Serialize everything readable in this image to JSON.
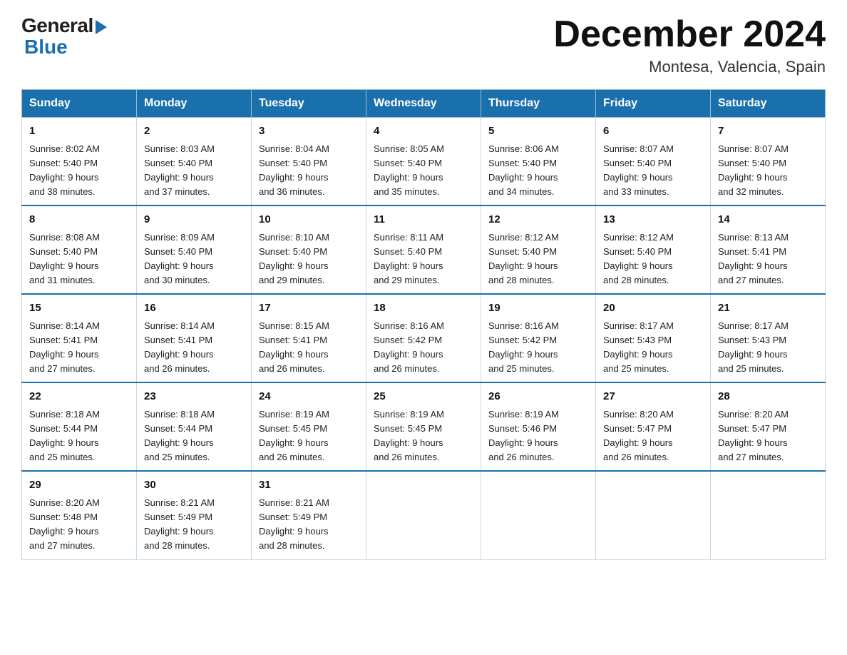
{
  "header": {
    "logo": {
      "general": "General",
      "blue": "Blue"
    },
    "title": "December 2024",
    "location": "Montesa, Valencia, Spain"
  },
  "calendar": {
    "days_of_week": [
      "Sunday",
      "Monday",
      "Tuesday",
      "Wednesday",
      "Thursday",
      "Friday",
      "Saturday"
    ],
    "weeks": [
      [
        {
          "day": "1",
          "sunrise": "8:02 AM",
          "sunset": "5:40 PM",
          "daylight": "9 hours and 38 minutes."
        },
        {
          "day": "2",
          "sunrise": "8:03 AM",
          "sunset": "5:40 PM",
          "daylight": "9 hours and 37 minutes."
        },
        {
          "day": "3",
          "sunrise": "8:04 AM",
          "sunset": "5:40 PM",
          "daylight": "9 hours and 36 minutes."
        },
        {
          "day": "4",
          "sunrise": "8:05 AM",
          "sunset": "5:40 PM",
          "daylight": "9 hours and 35 minutes."
        },
        {
          "day": "5",
          "sunrise": "8:06 AM",
          "sunset": "5:40 PM",
          "daylight": "9 hours and 34 minutes."
        },
        {
          "day": "6",
          "sunrise": "8:07 AM",
          "sunset": "5:40 PM",
          "daylight": "9 hours and 33 minutes."
        },
        {
          "day": "7",
          "sunrise": "8:07 AM",
          "sunset": "5:40 PM",
          "daylight": "9 hours and 32 minutes."
        }
      ],
      [
        {
          "day": "8",
          "sunrise": "8:08 AM",
          "sunset": "5:40 PM",
          "daylight": "9 hours and 31 minutes."
        },
        {
          "day": "9",
          "sunrise": "8:09 AM",
          "sunset": "5:40 PM",
          "daylight": "9 hours and 30 minutes."
        },
        {
          "day": "10",
          "sunrise": "8:10 AM",
          "sunset": "5:40 PM",
          "daylight": "9 hours and 29 minutes."
        },
        {
          "day": "11",
          "sunrise": "8:11 AM",
          "sunset": "5:40 PM",
          "daylight": "9 hours and 29 minutes."
        },
        {
          "day": "12",
          "sunrise": "8:12 AM",
          "sunset": "5:40 PM",
          "daylight": "9 hours and 28 minutes."
        },
        {
          "day": "13",
          "sunrise": "8:12 AM",
          "sunset": "5:40 PM",
          "daylight": "9 hours and 28 minutes."
        },
        {
          "day": "14",
          "sunrise": "8:13 AM",
          "sunset": "5:41 PM",
          "daylight": "9 hours and 27 minutes."
        }
      ],
      [
        {
          "day": "15",
          "sunrise": "8:14 AM",
          "sunset": "5:41 PM",
          "daylight": "9 hours and 27 minutes."
        },
        {
          "day": "16",
          "sunrise": "8:14 AM",
          "sunset": "5:41 PM",
          "daylight": "9 hours and 26 minutes."
        },
        {
          "day": "17",
          "sunrise": "8:15 AM",
          "sunset": "5:41 PM",
          "daylight": "9 hours and 26 minutes."
        },
        {
          "day": "18",
          "sunrise": "8:16 AM",
          "sunset": "5:42 PM",
          "daylight": "9 hours and 26 minutes."
        },
        {
          "day": "19",
          "sunrise": "8:16 AM",
          "sunset": "5:42 PM",
          "daylight": "9 hours and 25 minutes."
        },
        {
          "day": "20",
          "sunrise": "8:17 AM",
          "sunset": "5:43 PM",
          "daylight": "9 hours and 25 minutes."
        },
        {
          "day": "21",
          "sunrise": "8:17 AM",
          "sunset": "5:43 PM",
          "daylight": "9 hours and 25 minutes."
        }
      ],
      [
        {
          "day": "22",
          "sunrise": "8:18 AM",
          "sunset": "5:44 PM",
          "daylight": "9 hours and 25 minutes."
        },
        {
          "day": "23",
          "sunrise": "8:18 AM",
          "sunset": "5:44 PM",
          "daylight": "9 hours and 25 minutes."
        },
        {
          "day": "24",
          "sunrise": "8:19 AM",
          "sunset": "5:45 PM",
          "daylight": "9 hours and 26 minutes."
        },
        {
          "day": "25",
          "sunrise": "8:19 AM",
          "sunset": "5:45 PM",
          "daylight": "9 hours and 26 minutes."
        },
        {
          "day": "26",
          "sunrise": "8:19 AM",
          "sunset": "5:46 PM",
          "daylight": "9 hours and 26 minutes."
        },
        {
          "day": "27",
          "sunrise": "8:20 AM",
          "sunset": "5:47 PM",
          "daylight": "9 hours and 26 minutes."
        },
        {
          "day": "28",
          "sunrise": "8:20 AM",
          "sunset": "5:47 PM",
          "daylight": "9 hours and 27 minutes."
        }
      ],
      [
        {
          "day": "29",
          "sunrise": "8:20 AM",
          "sunset": "5:48 PM",
          "daylight": "9 hours and 27 minutes."
        },
        {
          "day": "30",
          "sunrise": "8:21 AM",
          "sunset": "5:49 PM",
          "daylight": "9 hours and 28 minutes."
        },
        {
          "day": "31",
          "sunrise": "8:21 AM",
          "sunset": "5:49 PM",
          "daylight": "9 hours and 28 minutes."
        },
        null,
        null,
        null,
        null
      ]
    ]
  }
}
